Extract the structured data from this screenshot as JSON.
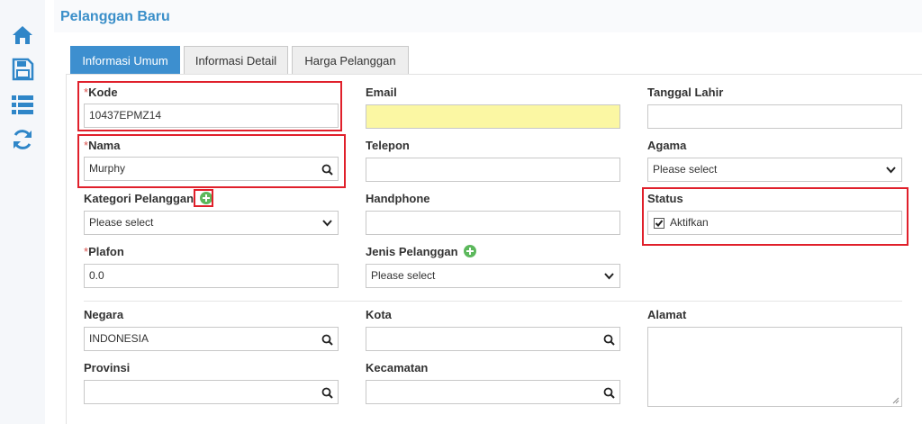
{
  "page": {
    "title": "Pelanggan Baru"
  },
  "sidebar": {
    "icons": [
      "home-icon",
      "save-icon",
      "list-icon",
      "refresh-icon"
    ]
  },
  "tabs": [
    {
      "label": "Informasi Umum",
      "active": true
    },
    {
      "label": "Informasi Detail",
      "active": false
    },
    {
      "label": "Harga Pelanggan",
      "active": false
    }
  ],
  "form": {
    "kode": {
      "label": "Kode",
      "required_mark": "*",
      "value": "10437EPMZ14"
    },
    "email": {
      "label": "Email",
      "value": ""
    },
    "tanggal_lahir": {
      "label": "Tanggal Lahir",
      "value": ""
    },
    "nama": {
      "label": "Nama",
      "required_mark": "*",
      "value": "Murphy"
    },
    "telepon": {
      "label": "Telepon",
      "value": ""
    },
    "agama": {
      "label": "Agama",
      "value": "Please select"
    },
    "kategori": {
      "label": "Kategori Pelanggan",
      "value": "Please select"
    },
    "handphone": {
      "label": "Handphone",
      "value": ""
    },
    "status": {
      "label": "Status",
      "checkbox_label": "Aktifkan",
      "checked": true
    },
    "plafon": {
      "label": "Plafon",
      "required_mark": "*",
      "value": "0.0"
    },
    "jenis": {
      "label": "Jenis Pelanggan",
      "value": "Please select"
    },
    "negara": {
      "label": "Negara",
      "value": "INDONESIA"
    },
    "kota": {
      "label": "Kota",
      "value": ""
    },
    "alamat": {
      "label": "Alamat",
      "value": ""
    },
    "provinsi": {
      "label": "Provinsi",
      "value": ""
    },
    "kecamatan": {
      "label": "Kecamatan",
      "value": ""
    }
  },
  "colors": {
    "accent": "#3d8fcf",
    "highlight": "#e0202b",
    "add": "#5cb85c",
    "email_bg": "#fbf7a3"
  }
}
